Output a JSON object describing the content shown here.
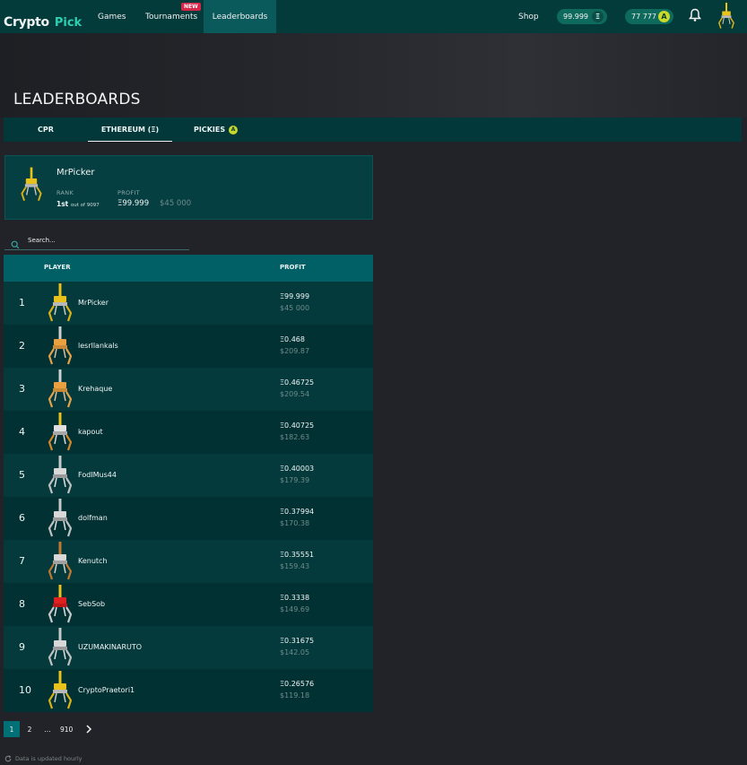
{
  "brand": {
    "word1": "Crypto",
    "word2": "Pick"
  },
  "nav": {
    "games": "Games",
    "tournaments": "Tournaments",
    "new_badge": "NEW",
    "leaderboards": "Leaderboards",
    "shop": "Shop",
    "eth_balance": "99.999",
    "eth_symbol": "Ξ",
    "pickies_balance": "77 777",
    "pickies_symbol": "A"
  },
  "page": {
    "title": "LEADERBOARDS",
    "tabs": [
      {
        "label": "CPR"
      },
      {
        "label": "ETHEREUM (Ξ)"
      },
      {
        "label": "PICKIES",
        "icon": "A"
      }
    ],
    "active_tab": "ETHEREUM (Ξ)"
  },
  "profile": {
    "name": "MrPicker",
    "rank_label": "RANK",
    "rank_value": "1st",
    "rank_suffix": "out of 9097",
    "profit_label": "PROFIT",
    "profit_eth": "Ξ99.999",
    "profit_usd": "$45 000"
  },
  "search": {
    "placeholder": "Search..."
  },
  "table": {
    "headers": {
      "player": "PLAYER",
      "profit": "PROFIT"
    },
    "rows": [
      {
        "rank": "1",
        "name": "MrPicker",
        "eth": "Ξ99.999",
        "usd": "$45 000",
        "avatar": "yellow-claw"
      },
      {
        "rank": "2",
        "name": "lesrllankals",
        "eth": "Ξ0.468",
        "usd": "$209.87",
        "avatar": "orange-claw"
      },
      {
        "rank": "3",
        "name": "Krehaque",
        "eth": "Ξ0.46725",
        "usd": "$209.54",
        "avatar": "orange-claw"
      },
      {
        "rank": "4",
        "name": "kapout",
        "eth": "Ξ0.40725",
        "usd": "$182.63",
        "avatar": "yellow-silver-claw"
      },
      {
        "rank": "5",
        "name": "FodIMus44",
        "eth": "Ξ0.40003",
        "usd": "$179.39",
        "avatar": "silver-claw"
      },
      {
        "rank": "6",
        "name": "dolfman",
        "eth": "Ξ0.37994",
        "usd": "$170.38",
        "avatar": "silver-claw"
      },
      {
        "rank": "7",
        "name": "Kenutch",
        "eth": "Ξ0.35551",
        "usd": "$159.43",
        "avatar": "bronze-claw"
      },
      {
        "rank": "8",
        "name": "SebSob",
        "eth": "Ξ0.3338",
        "usd": "$149.69",
        "avatar": "red-claw"
      },
      {
        "rank": "9",
        "name": "UZUMAKINARUTO",
        "eth": "Ξ0.31675",
        "usd": "$142.05",
        "avatar": "silver-claw"
      },
      {
        "rank": "10",
        "name": "CryptoPraetori1",
        "eth": "Ξ0.26576",
        "usd": "$119.18",
        "avatar": "yellow-claw"
      }
    ]
  },
  "pagination": {
    "pages": [
      "1",
      "2",
      "...",
      "910"
    ],
    "active": "1",
    "next_label": "›"
  },
  "footnote": "Data is updated hourly",
  "colors": {
    "topbar": "#033a3a",
    "active_nav": "#0a5a5c",
    "accent_teal": "#006066",
    "pickies_yellow": "#c8d92b",
    "new_badge": "#d6264a"
  }
}
